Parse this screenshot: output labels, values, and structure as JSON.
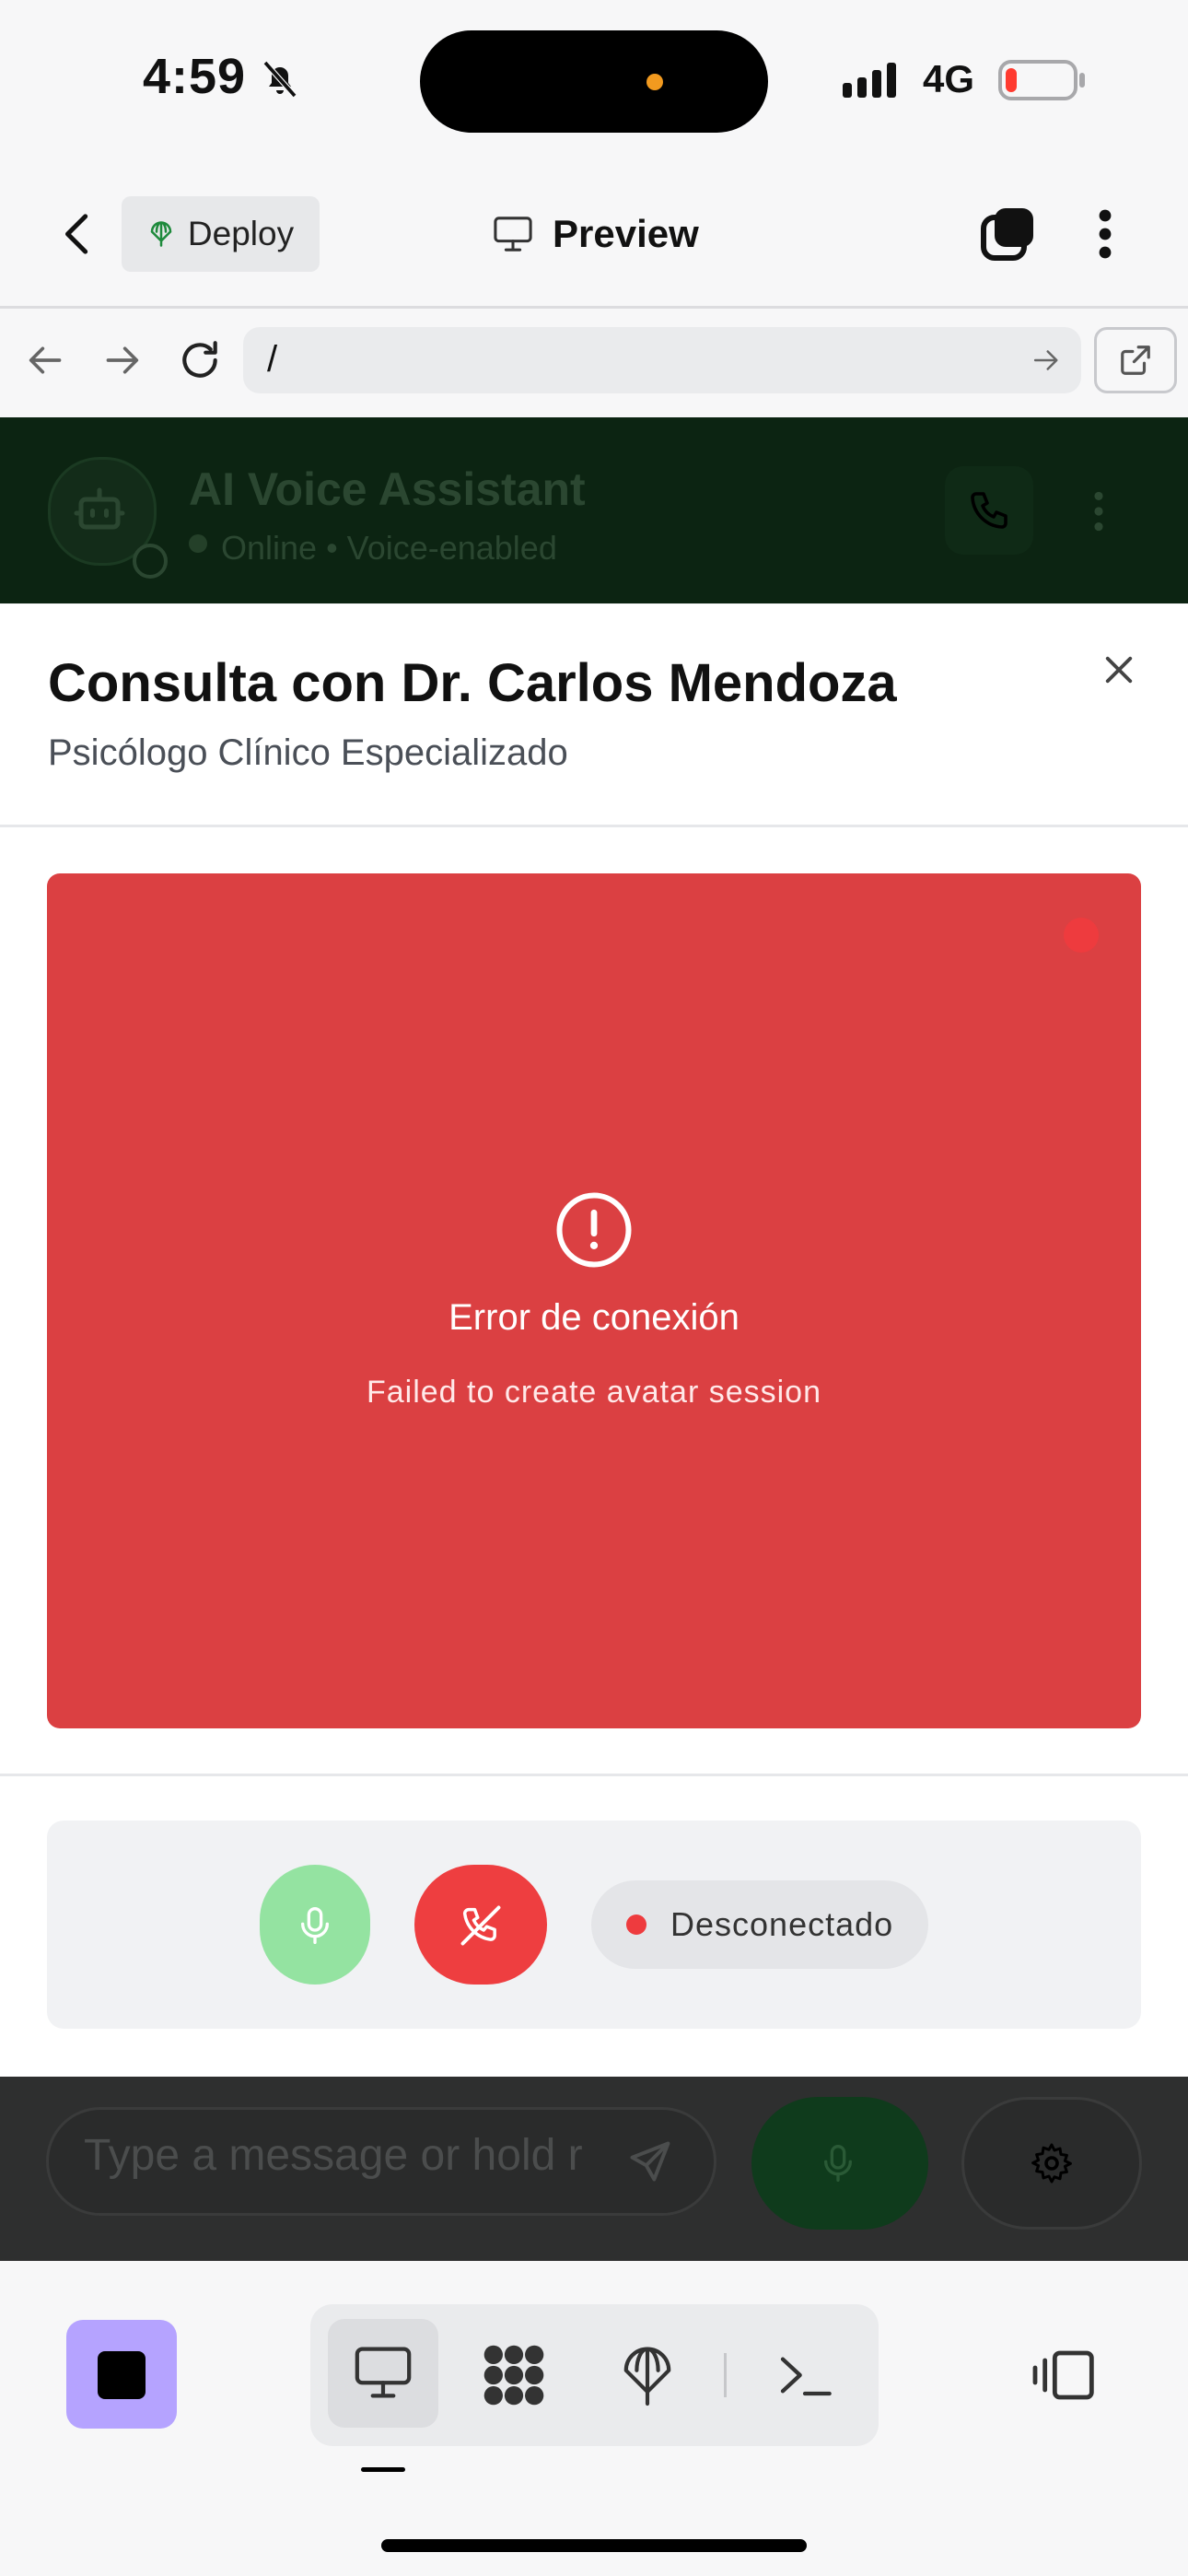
{
  "status_bar": {
    "time": "4:59",
    "network": "4G"
  },
  "app_header": {
    "deploy_label": "Deploy",
    "title": "Preview"
  },
  "browser": {
    "url": "/"
  },
  "background_app": {
    "title": "AI Voice Assistant",
    "status": "Online • Voice-enabled",
    "input_placeholder": "Type a message or hold r"
  },
  "modal": {
    "title": "Consulta con Dr. Carlos Mendoza",
    "subtitle": "Psicólogo Clínico Especializado",
    "error_title": "Error de conexión",
    "error_message": "Failed to create avatar session",
    "connection_status": "Desconectado"
  },
  "colors": {
    "error_panel": "#db4042",
    "accent_green": "#94e3a1",
    "hangup_red": "#ee3e40",
    "stop_button": "#b5a3ff"
  },
  "icons": [
    "bell-slash-icon",
    "signal-icon",
    "battery-icon",
    "back-arrow-icon",
    "deploy-icon",
    "monitor-icon",
    "tabs-icon",
    "more-vertical-icon",
    "browser-back-icon",
    "browser-forward-icon",
    "reload-icon",
    "url-go-icon",
    "external-link-icon",
    "bot-icon",
    "phone-icon",
    "close-icon",
    "alert-circle-icon",
    "mic-icon",
    "phone-off-icon",
    "send-icon",
    "settings-icon",
    "stop-icon",
    "grid-icon",
    "terminal-icon",
    "split-view-icon"
  ]
}
